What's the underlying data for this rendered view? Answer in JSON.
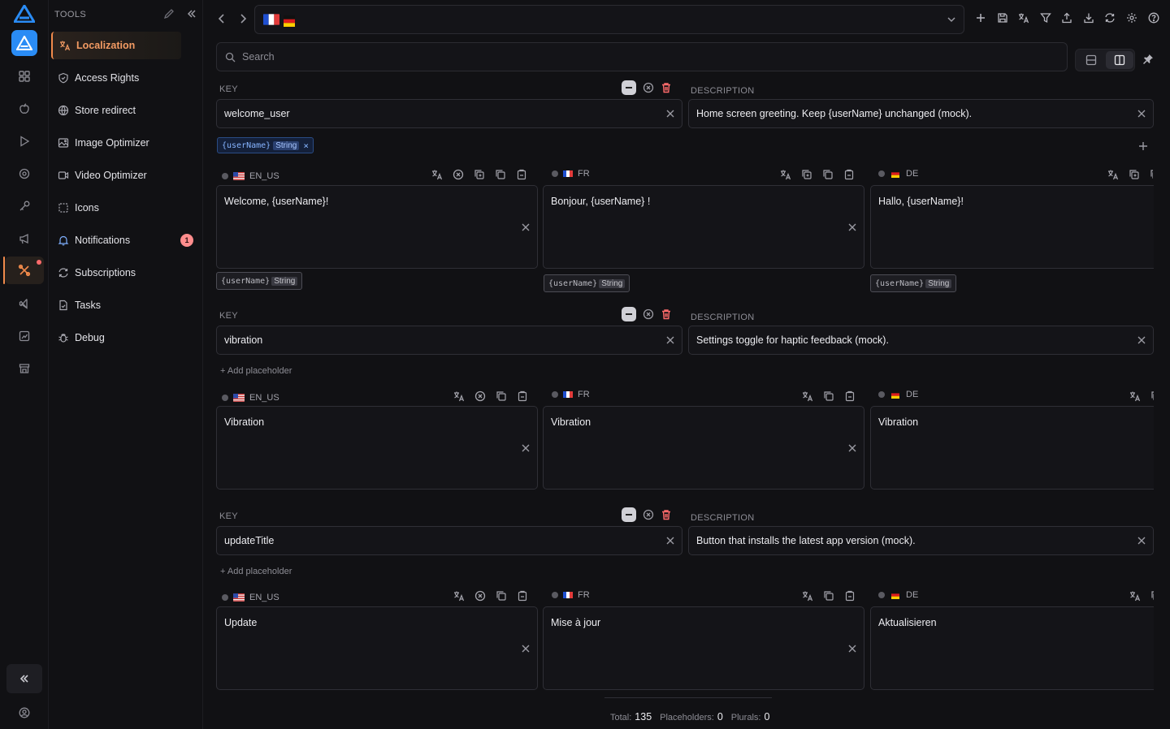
{
  "tools": {
    "title": "TOOLS",
    "items": [
      {
        "label": "Localization",
        "icon": "translate-icon",
        "active": true
      },
      {
        "label": "Access Rights",
        "icon": "shield-icon"
      },
      {
        "label": "Store redirect",
        "icon": "globe-icon"
      },
      {
        "label": "Image Optimizer",
        "icon": "image-icon"
      },
      {
        "label": "Video Optimizer",
        "icon": "video-icon"
      },
      {
        "label": "Icons",
        "icon": "dashed-square-icon"
      },
      {
        "label": "Notifications",
        "icon": "bell-icon",
        "badge": "1"
      },
      {
        "label": "Subscriptions",
        "icon": "refresh-icon"
      },
      {
        "label": "Tasks",
        "icon": "clipboard-icon"
      },
      {
        "label": "Debug",
        "icon": "bug-icon"
      }
    ]
  },
  "search": {
    "placeholder": "Search"
  },
  "labels": {
    "key": "KEY",
    "description": "DESCRIPTION",
    "add_placeholder": "+ Add placeholder"
  },
  "entries": [
    {
      "key": "welcome_user",
      "description": "Home screen greeting. Keep {userName} unchanged (mock).",
      "placeholder": {
        "name": "{userName}",
        "type": "String"
      },
      "translations": [
        {
          "lang": "EN_US",
          "text": "Welcome, {userName}!"
        },
        {
          "lang": "FR",
          "text": "Bonjour, {userName} !"
        },
        {
          "lang": "DE",
          "text": "Hallo, {userName}!"
        }
      ]
    },
    {
      "key": "vibration",
      "description": "Settings toggle for haptic feedback (mock).",
      "translations": [
        {
          "lang": "EN_US",
          "text": "Vibration"
        },
        {
          "lang": "FR",
          "text": "Vibration"
        },
        {
          "lang": "DE",
          "text": "Vibration"
        }
      ]
    },
    {
      "key": "updateTitle",
      "description": "Button that installs the latest app version (mock).",
      "translations": [
        {
          "lang": "EN_US",
          "text": "Update"
        },
        {
          "lang": "FR",
          "text": "Mise à jour"
        },
        {
          "lang": "DE",
          "text": "Aktualisieren"
        }
      ]
    }
  ],
  "footer": {
    "total_label": "Total:",
    "total": "135",
    "placeholders_label": "Placeholders:",
    "placeholders": "0",
    "plurals_label": "Plurals:",
    "plurals": "0"
  },
  "colors": {
    "accent": "#f08a4b",
    "app_icon": "#2a8cf5",
    "chip_blue": "#86b4ff",
    "badge": "#ff8d8d"
  }
}
